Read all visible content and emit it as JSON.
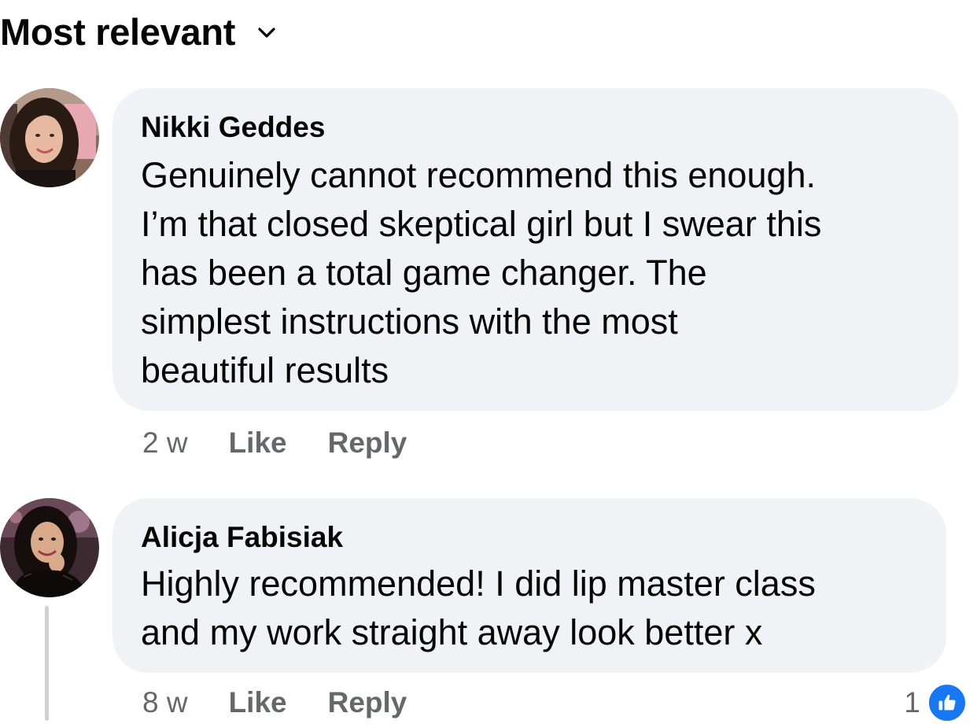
{
  "sort": {
    "label": "Most relevant",
    "icon": "chevron-down-icon"
  },
  "comments": [
    {
      "author": "Nikki Geddes",
      "text": "Genuinely cannot recommend this enough.\nI’m that closed skeptical girl but I swear this\nhas been a total game changer. The\nsimplest instructions with the most\nbeautiful results",
      "timestamp": "2 w",
      "like_label": "Like",
      "reply_label": "Reply"
    },
    {
      "author": "Alicja Fabisiak",
      "text": "Highly recommended! I did lip master class\nand my work straight away look better x",
      "timestamp": "8 w",
      "like_label": "Like",
      "reply_label": "Reply",
      "reaction_count": "1",
      "reaction_icon": "thumbs-up-icon"
    }
  ],
  "colors": {
    "bubble": "#f0f2f5",
    "meta_text": "#65676b",
    "like_blue": "#1877f2"
  }
}
